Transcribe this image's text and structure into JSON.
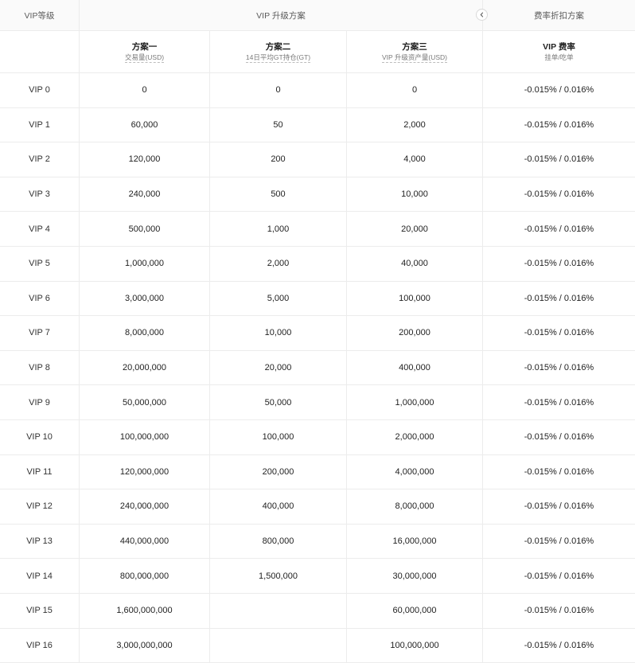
{
  "header": {
    "vip_level": "VIP等级",
    "upgrade_plans": "VIP 升级方案",
    "fee_discount": "费率折扣方案"
  },
  "columns": {
    "plan1": {
      "title": "方案一",
      "subtitle": "交易量(USD)"
    },
    "plan2": {
      "title": "方案二",
      "subtitle": "14日平均GT持仓(GT)"
    },
    "plan3": {
      "title": "方案三",
      "subtitle": "VIP 升级资产量(USD)"
    },
    "fee": {
      "title": "VIP 费率",
      "subtitle": "挂单/吃单"
    }
  },
  "rows": [
    {
      "level": "VIP 0",
      "plan1": "0",
      "plan2": "0",
      "plan3": "0",
      "fee": "-0.015% / 0.016%"
    },
    {
      "level": "VIP 1",
      "plan1": "60,000",
      "plan2": "50",
      "plan3": "2,000",
      "fee": "-0.015% / 0.016%"
    },
    {
      "level": "VIP 2",
      "plan1": "120,000",
      "plan2": "200",
      "plan3": "4,000",
      "fee": "-0.015% / 0.016%"
    },
    {
      "level": "VIP 3",
      "plan1": "240,000",
      "plan2": "500",
      "plan3": "10,000",
      "fee": "-0.015% / 0.016%"
    },
    {
      "level": "VIP 4",
      "plan1": "500,000",
      "plan2": "1,000",
      "plan3": "20,000",
      "fee": "-0.015% / 0.016%"
    },
    {
      "level": "VIP 5",
      "plan1": "1,000,000",
      "plan2": "2,000",
      "plan3": "40,000",
      "fee": "-0.015% / 0.016%"
    },
    {
      "level": "VIP 6",
      "plan1": "3,000,000",
      "plan2": "5,000",
      "plan3": "100,000",
      "fee": "-0.015% / 0.016%"
    },
    {
      "level": "VIP 7",
      "plan1": "8,000,000",
      "plan2": "10,000",
      "plan3": "200,000",
      "fee": "-0.015% / 0.016%"
    },
    {
      "level": "VIP 8",
      "plan1": "20,000,000",
      "plan2": "20,000",
      "plan3": "400,000",
      "fee": "-0.015% / 0.016%"
    },
    {
      "level": "VIP 9",
      "plan1": "50,000,000",
      "plan2": "50,000",
      "plan3": "1,000,000",
      "fee": "-0.015% / 0.016%"
    },
    {
      "level": "VIP 10",
      "plan1": "100,000,000",
      "plan2": "100,000",
      "plan3": "2,000,000",
      "fee": "-0.015% / 0.016%"
    },
    {
      "level": "VIP 11",
      "plan1": "120,000,000",
      "plan2": "200,000",
      "plan3": "4,000,000",
      "fee": "-0.015% / 0.016%"
    },
    {
      "level": "VIP 12",
      "plan1": "240,000,000",
      "plan2": "400,000",
      "plan3": "8,000,000",
      "fee": "-0.015% / 0.016%"
    },
    {
      "level": "VIP 13",
      "plan1": "440,000,000",
      "plan2": "800,000",
      "plan3": "16,000,000",
      "fee": "-0.015% / 0.016%"
    },
    {
      "level": "VIP 14",
      "plan1": "800,000,000",
      "plan2": "1,500,000",
      "plan3": "30,000,000",
      "fee": "-0.015% / 0.016%"
    },
    {
      "level": "VIP 15",
      "plan1": "1,600,000,000",
      "plan2": "",
      "plan3": "60,000,000",
      "fee": "-0.015% / 0.016%"
    },
    {
      "level": "VIP 16",
      "plan1": "3,000,000,000",
      "plan2": "",
      "plan3": "100,000,000",
      "fee": "-0.015% / 0.016%"
    }
  ],
  "icons": {
    "collapse": "chevron-left-icon"
  }
}
